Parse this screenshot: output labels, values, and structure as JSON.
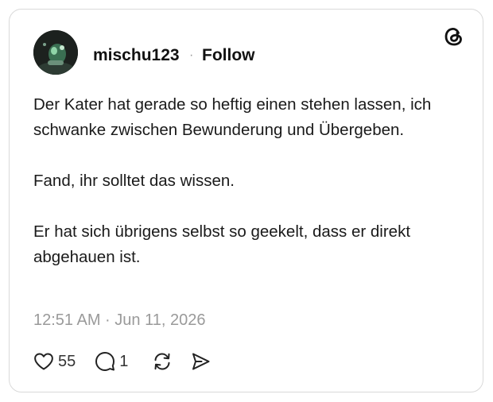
{
  "post": {
    "author": {
      "username": "mischu123",
      "separator": "·",
      "follow_label": "Follow"
    },
    "text_paragraphs": [
      "Der Kater hat gerade so heftig einen stehen lassen, ich schwanke zwischen Bewunderung und Übergeben.",
      "Fand, ihr solltet das wissen.",
      "Er hat sich übrigens selbst so geekelt, dass er direkt abgehauen ist."
    ],
    "timestamp": "12:51 AM · Jun 11, 2026",
    "stats": {
      "likes": "55",
      "replies": "1"
    },
    "icons": {
      "platform": "threads-logo-icon",
      "like": "heart-icon",
      "reply": "speech-bubble-icon",
      "repost": "repost-icon",
      "share": "send-icon"
    }
  }
}
